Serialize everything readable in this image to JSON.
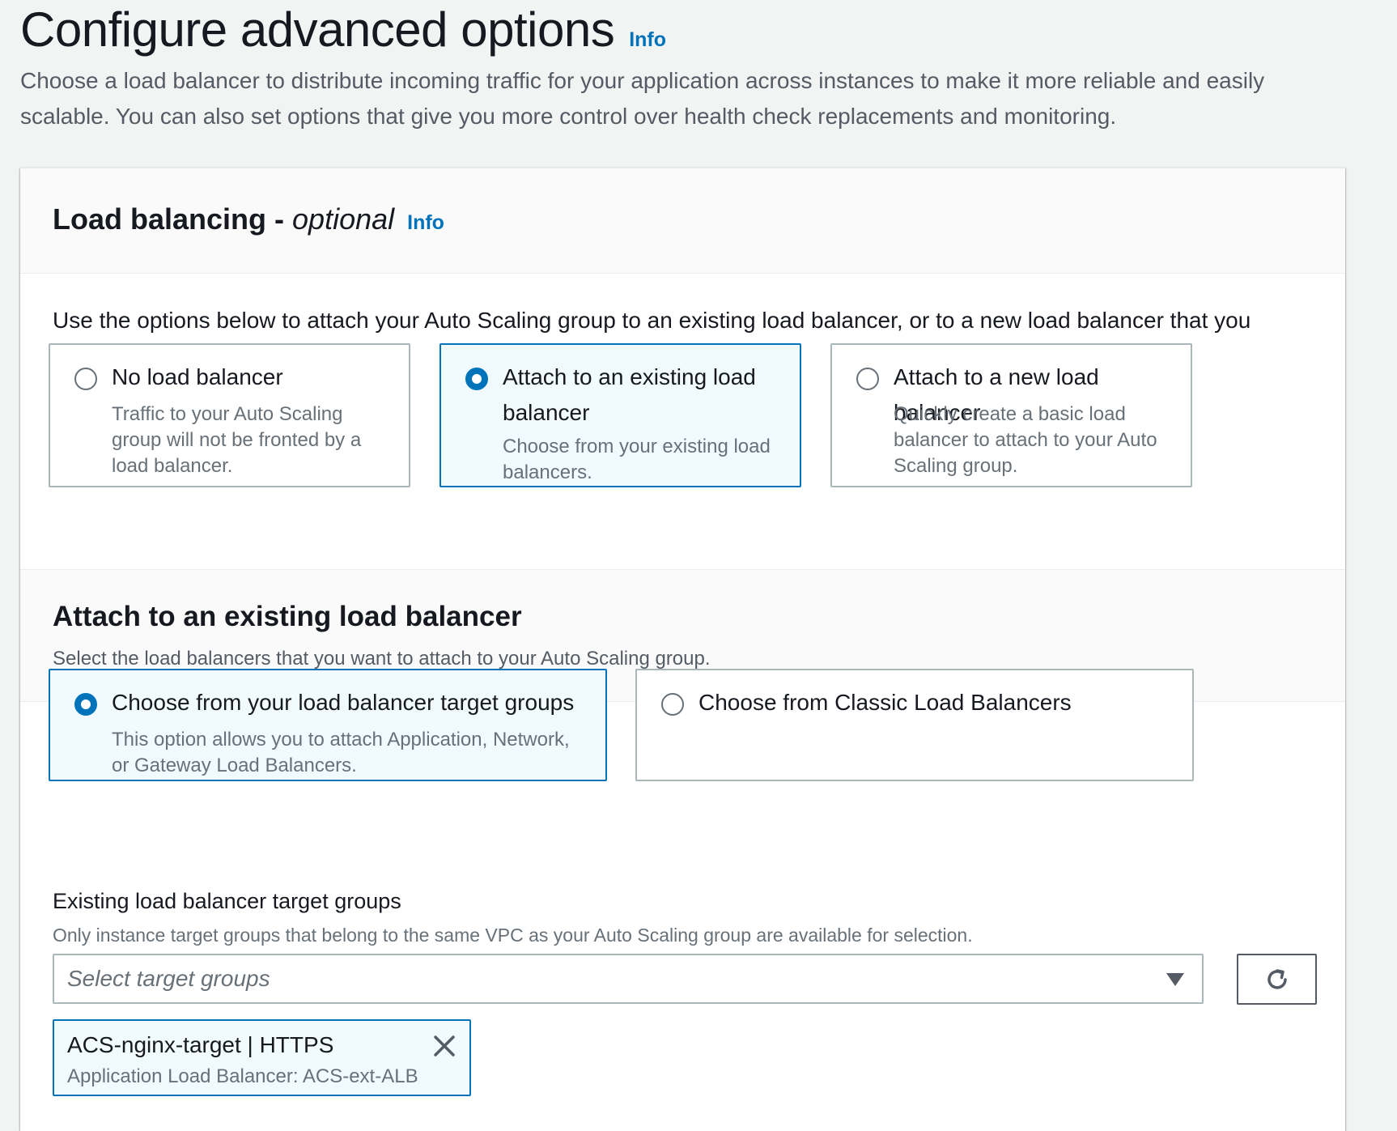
{
  "header": {
    "title": "Configure advanced options",
    "info": "Info",
    "description": "Choose a load balancer to distribute incoming traffic for your application across instances to make it more reliable and easily scalable. You can also set options that give you more control over health check replacements and monitoring."
  },
  "load_balancing": {
    "title": "Load balancing -",
    "title_optional": "optional",
    "info": "Info",
    "intro": "Use the options below to attach your Auto Scaling group to an existing load balancer, or to a new load balancer that you define.",
    "options": [
      {
        "label": "No load balancer",
        "description": "Traffic to your Auto Scaling group will not be fronted by a load balancer.",
        "selected": false
      },
      {
        "label": "Attach to an existing load balancer",
        "description": "Choose from your existing load balancers.",
        "selected": true
      },
      {
        "label": "Attach to a new load balancer",
        "description": "Quickly create a basic load balancer to attach to your Auto Scaling group.",
        "selected": false
      }
    ]
  },
  "existing_lb": {
    "title": "Attach to an existing load balancer",
    "description": "Select the load balancers that you want to attach to your Auto Scaling group.",
    "options": [
      {
        "label": "Choose from your load balancer target groups",
        "description": "This option allows you to attach Application, Network, or Gateway Load Balancers.",
        "selected": true
      },
      {
        "label": "Choose from Classic Load Balancers",
        "description": "",
        "selected": false
      }
    ],
    "target_groups": {
      "label": "Existing load balancer target groups",
      "description": "Only instance target groups that belong to the same VPC as your Auto Scaling group are available for selection.",
      "placeholder": "Select target groups",
      "refresh_icon": "refresh-icon",
      "selected": [
        {
          "label": "ACS-nginx-target | HTTPS",
          "description": "Application Load Balancer: ACS-ext-ALB"
        }
      ]
    }
  },
  "colors": {
    "accent": "#0073bb",
    "selected_bg": "#f1faff",
    "page_bg": "#f2f3f3"
  }
}
